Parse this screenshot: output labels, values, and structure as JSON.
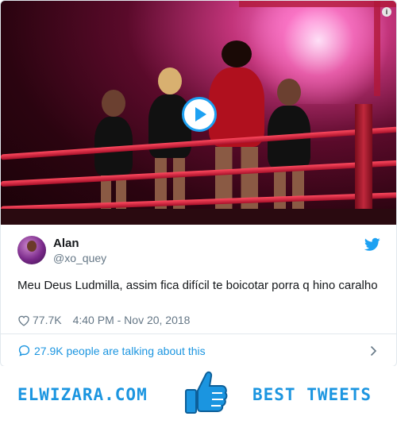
{
  "media": {
    "icons": {
      "play": "play-icon",
      "info": "info-icon"
    },
    "info_glyph": "i"
  },
  "tweet": {
    "author": {
      "name": "Alan",
      "handle": "@xo_quey"
    },
    "text": "Meu Deus Ludmilla, assim fica difícil te boicotar porra q hino caralho",
    "likes": "77.7K",
    "timestamp": "4:40 PM - Nov 20, 2018",
    "icons": {
      "brand": "twitter-bird-icon",
      "like": "heart-icon"
    }
  },
  "conversation": {
    "label": "27.9K people are talking about this",
    "icons": {
      "bubble": "speech-bubble-icon",
      "chevron": "chevron-right-icon"
    }
  },
  "footer": {
    "left_text": "ELWIZARA.COM",
    "right_text": "BEST TWEETS",
    "icon": "thumbs-up-icon"
  },
  "colors": {
    "accent": "#1da1f2",
    "link": "#1b95e0",
    "muted": "#657786",
    "text": "#14171a"
  }
}
